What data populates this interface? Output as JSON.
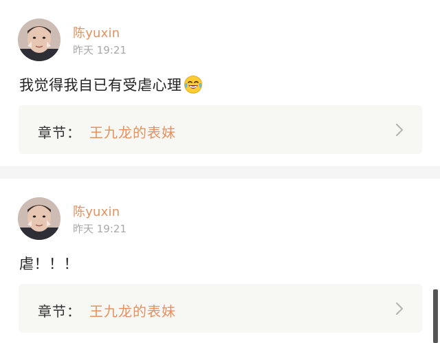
{
  "comments": [
    {
      "username": "陈yuxin",
      "timestamp": "昨天 19:21",
      "text": "我觉得我自已有受虐心理",
      "emoji": "laughing-tears-emoji",
      "chapter": {
        "label": "章节：",
        "title": "王九龙的表妹"
      }
    },
    {
      "username": "陈yuxin",
      "timestamp": "昨天 19:21",
      "text": "虐！！！",
      "emoji": "",
      "chapter": {
        "label": "章节：",
        "title": "王九龙的表妹"
      }
    }
  ],
  "colors": {
    "accent": "#e8905d",
    "card_bg": "#f7f7f4",
    "divider": "#f5f5f5",
    "muted": "#a8a8a8"
  }
}
